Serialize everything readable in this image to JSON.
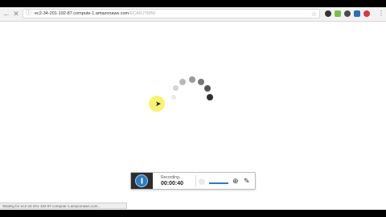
{
  "browser": {
    "url_host": "ec2-34-201-192-87.compute-1.amazonaws.com",
    "url_path": "/ECARJTMNI",
    "back_icon": "back-arrow-icon",
    "forward_icon": "forward-arrow-icon",
    "reload_icon": "close-x-icon"
  },
  "spinner": {
    "dots": [
      {
        "color": "#e9e9e9"
      },
      {
        "color": "#d4d4d4"
      },
      {
        "color": "#b9b9b9"
      },
      {
        "color": "#9a9a9a"
      },
      {
        "color": "#777777"
      },
      {
        "color": "#555555"
      },
      {
        "color": "#2f2f2f"
      }
    ]
  },
  "recorder": {
    "status": "Recording...",
    "time": "00:00:40"
  },
  "status_bar": {
    "text": "Waiting for ec2-34-201-192-87.compute-1.amazonaws.com..."
  },
  "colors": {
    "accent": "#2b7cc2",
    "highlight": "#f7f25a"
  }
}
